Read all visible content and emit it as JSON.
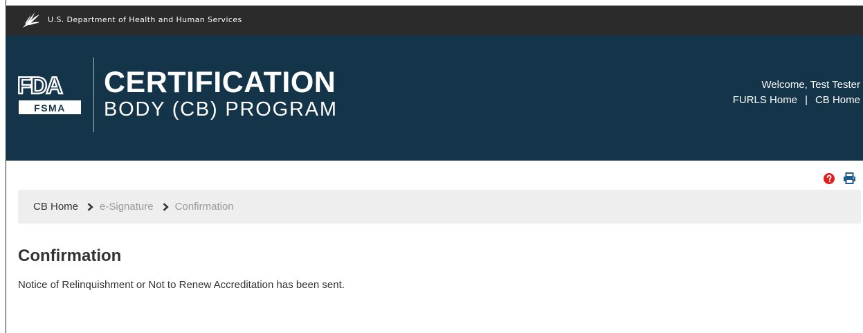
{
  "hhs_bar": {
    "text": "U.S. Department of Health and Human Services"
  },
  "logo": {
    "fda": "FDA",
    "fsma": "FSMA"
  },
  "program": {
    "title": "CERTIFICATION",
    "subtitle": "BODY (CB) PROGRAM"
  },
  "user": {
    "welcome": "Welcome, Test Tester",
    "links": [
      {
        "label": "FURLS Home"
      },
      {
        "label": "CB Home"
      }
    ],
    "separator": "|"
  },
  "tools": [
    {
      "icon": "help-icon"
    },
    {
      "icon": "print-icon"
    }
  ],
  "breadcrumb": [
    {
      "label": "CB Home"
    },
    {
      "label": "e-Signature"
    },
    {
      "label": "Confirmation"
    }
  ],
  "page": {
    "title": "Confirmation",
    "message": "Notice of Relinquishment or Not to Renew Accreditation has been sent."
  },
  "colors": {
    "hhs_bar": "#2b2b2b",
    "header": "#14344a",
    "breadcrumb_bg": "#eeeeee",
    "help_icon": "#e21b1b",
    "print_icon": "#1f5a8a"
  }
}
